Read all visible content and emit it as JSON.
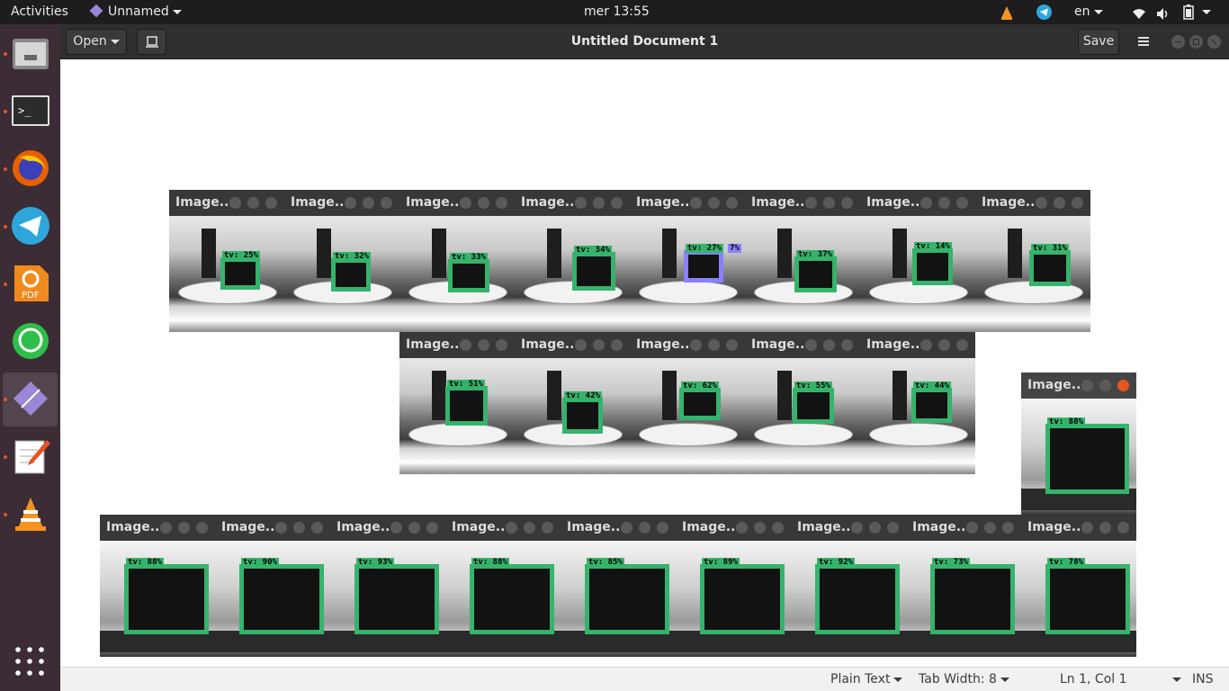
{
  "topbar": {
    "activities": "Activities",
    "app_menu": "Unnamed",
    "clock": "mer 13:55",
    "keyboard": "en"
  },
  "dock": {
    "apps": [
      "Files",
      "Terminal",
      "Firefox",
      "Telegram",
      "Foxit PDF",
      "WhatsApp",
      "Unnamed",
      "Text Editor",
      "VLC"
    ],
    "show_apps_icon": "grid-icon"
  },
  "header": {
    "open_label": "Open",
    "title": "Untitled Document 1",
    "save_label": "Save"
  },
  "statusbar": {
    "language": "Plain Text",
    "tab_width": "Tab Width: 8",
    "position": "Ln 1, Col 1",
    "mode": "INS"
  },
  "windows": {
    "title": "Image...",
    "row1": [
      {
        "label": "tv: 25%"
      },
      {
        "label": "tv: 32%"
      },
      {
        "label": "tv: 33%"
      },
      {
        "label": "tv: 34%"
      },
      {
        "label": "tv: 27%",
        "extra_label": "7%"
      },
      {
        "label": "tv: 37%"
      },
      {
        "label": "tv: 14%"
      },
      {
        "label": "tv: 31%"
      }
    ],
    "row2": [
      {
        "label": "tv: 51%"
      },
      {
        "label": "tv: 42%"
      },
      {
        "label": "tv: 62%"
      },
      {
        "label": "tv: 55%"
      },
      {
        "label": "tv: 44%"
      }
    ],
    "focused": {
      "label": "tv: 88%"
    },
    "row3": [
      {
        "label": "tv: 88%"
      },
      {
        "label": "tv: 90%"
      },
      {
        "label": "tv: 93%"
      },
      {
        "label": "tv: 88%"
      },
      {
        "label": "tv: 85%"
      },
      {
        "label": "tv: 89%"
      },
      {
        "label": "tv: 92%"
      },
      {
        "label": "tv: 73%"
      },
      {
        "label": "tv: 78%"
      }
    ]
  },
  "colors": {
    "detection_box": "#35b36b",
    "close_active": "#e9541f",
    "dock_bg": "#3b2c35",
    "secondary_box": "#8a80ff"
  }
}
